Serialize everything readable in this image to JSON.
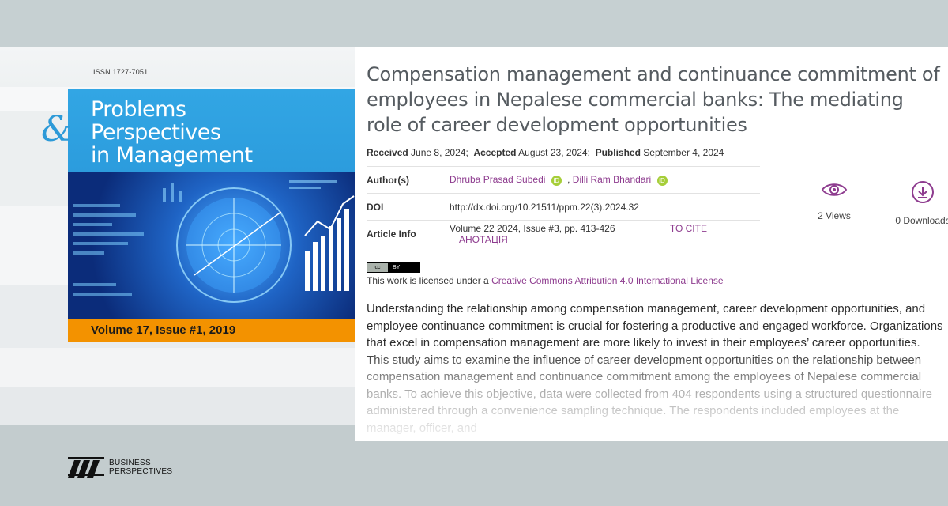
{
  "journal": {
    "issn": "ISSN 1727-7051",
    "title_line1": "Problems",
    "title_line2": "Perspectives",
    "title_line3": "in Management",
    "amp": "&",
    "volume": "Volume 17, Issue #1, 2019"
  },
  "article": {
    "title": "Compensation management and continuance commitment of employees in Nepalese commercial banks: The mediating role of career development opportunities",
    "received_label": "Received",
    "received": "June 8, 2024;",
    "accepted_label": "Accepted",
    "accepted": "August 23, 2024;",
    "published_label": "Published",
    "published": "September 4, 2024",
    "authors_label": "Author(s)",
    "author1": "Dhruba Prasad Subedi",
    "author_sep": ",",
    "author2": "Dilli Ram Bhandari",
    "orcid": "iD",
    "doi_label": "DOI",
    "doi": "http://dx.doi.org/10.21511/ppm.22(3).2024.32",
    "info_label": "Article Info",
    "info": "Volume 22 2024, Issue #3, pp. 413-426",
    "to_cite": "TO CITE",
    "annotation": "АНОТАЦІЯ"
  },
  "stats": {
    "views": "2 Views",
    "downloads": "0 Downloads"
  },
  "license": {
    "badge_left": "cc",
    "badge_right": "BY",
    "prefix": "This work is licensed under a ",
    "link": "Creative Commons Attribution 4.0 International License"
  },
  "abstract": "Understanding the relationship among compensation management, career development opportunities, and employee continuance commitment is crucial for fostering a productive and engaged workforce. Organizations that excel in compensation management are more likely to invest in their employees’ career opportunities. This study aims to examine the influence of career development opportunities on the relationship between compensation management and continuance commitment among the employees of Nepalese commercial banks. To achieve this objective, data were collected from 404 respondents using a structured questionnaire administered through a convenience sampling technique. The respondents included employees at the manager, officer, and",
  "publisher": {
    "line1": "BUSINESS",
    "line2": "PERSPECTIVES"
  },
  "colors": {
    "accent": "#8e3c8f",
    "cover_blue": "#2d9ad8",
    "cover_orange": "#f39200"
  }
}
